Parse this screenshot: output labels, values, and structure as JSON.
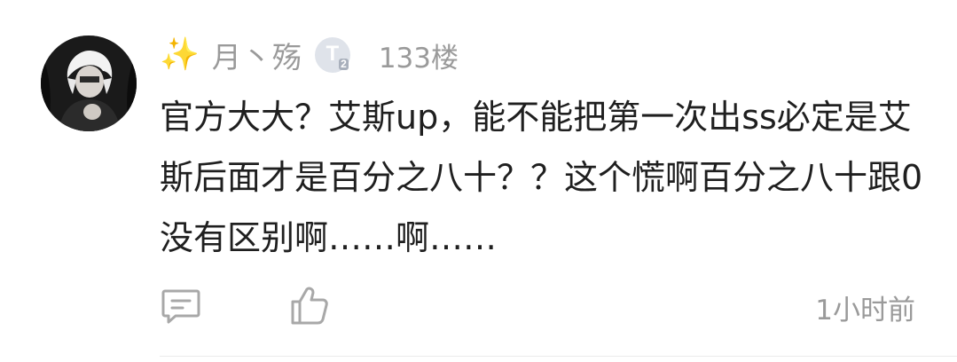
{
  "comment": {
    "avatar_alt": "user-avatar",
    "decoration": "✨",
    "username": "月丶殇",
    "level_badge": {
      "letter": "T",
      "sub": "2",
      "icon": "level-badge-icon"
    },
    "floor": "133楼",
    "text": "官方大大？艾斯up，能不能把第一次出ss必定是艾斯后面才是百分之八十？？这个慌啊百分之八十跟0没有区别啊……啊……",
    "actions": {
      "reply_icon": "comment-icon",
      "like_icon": "thumbs-up-icon"
    },
    "timestamp": "1小时前"
  },
  "colors": {
    "meta_text": "#9a9a9a",
    "body_text": "#1f1f1f",
    "badge_bg": "#dfe3ea",
    "sparkle": "#f5b800"
  }
}
